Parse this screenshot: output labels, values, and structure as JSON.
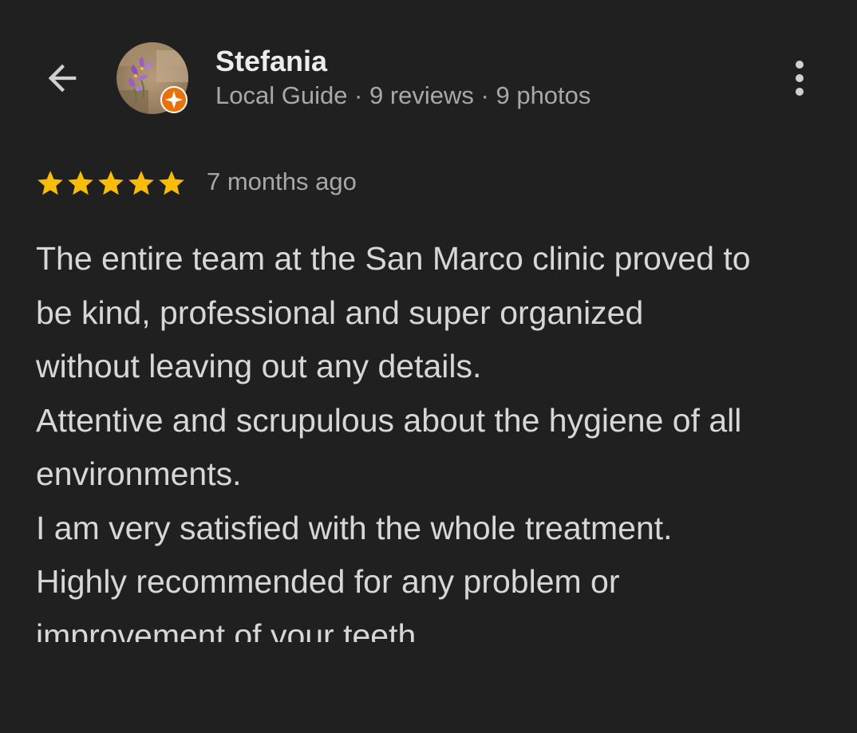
{
  "header": {
    "back_icon": "arrow-left-icon",
    "more_icon": "more-vert-icon",
    "avatar_icon": "avatar-photo",
    "badge_icon": "local-guide-badge-icon",
    "badge_color": "#e8710a"
  },
  "reviewer": {
    "name": "Stefania",
    "meta": "Local Guide · 9 reviews · 9 photos"
  },
  "review": {
    "rating": 5,
    "max_rating": 5,
    "star_color": "#fbbc04",
    "date": "7 months ago",
    "lines": [
      "The entire team at the San Marco clinic proved to",
      "be kind, professional and super organized",
      "without leaving out any details.",
      "Attentive and scrupulous about the hygiene of all",
      "environments.",
      "I am very satisfied with the whole treatment.",
      "Highly recommended for any problem or",
      "improvement of your teeth."
    ]
  }
}
